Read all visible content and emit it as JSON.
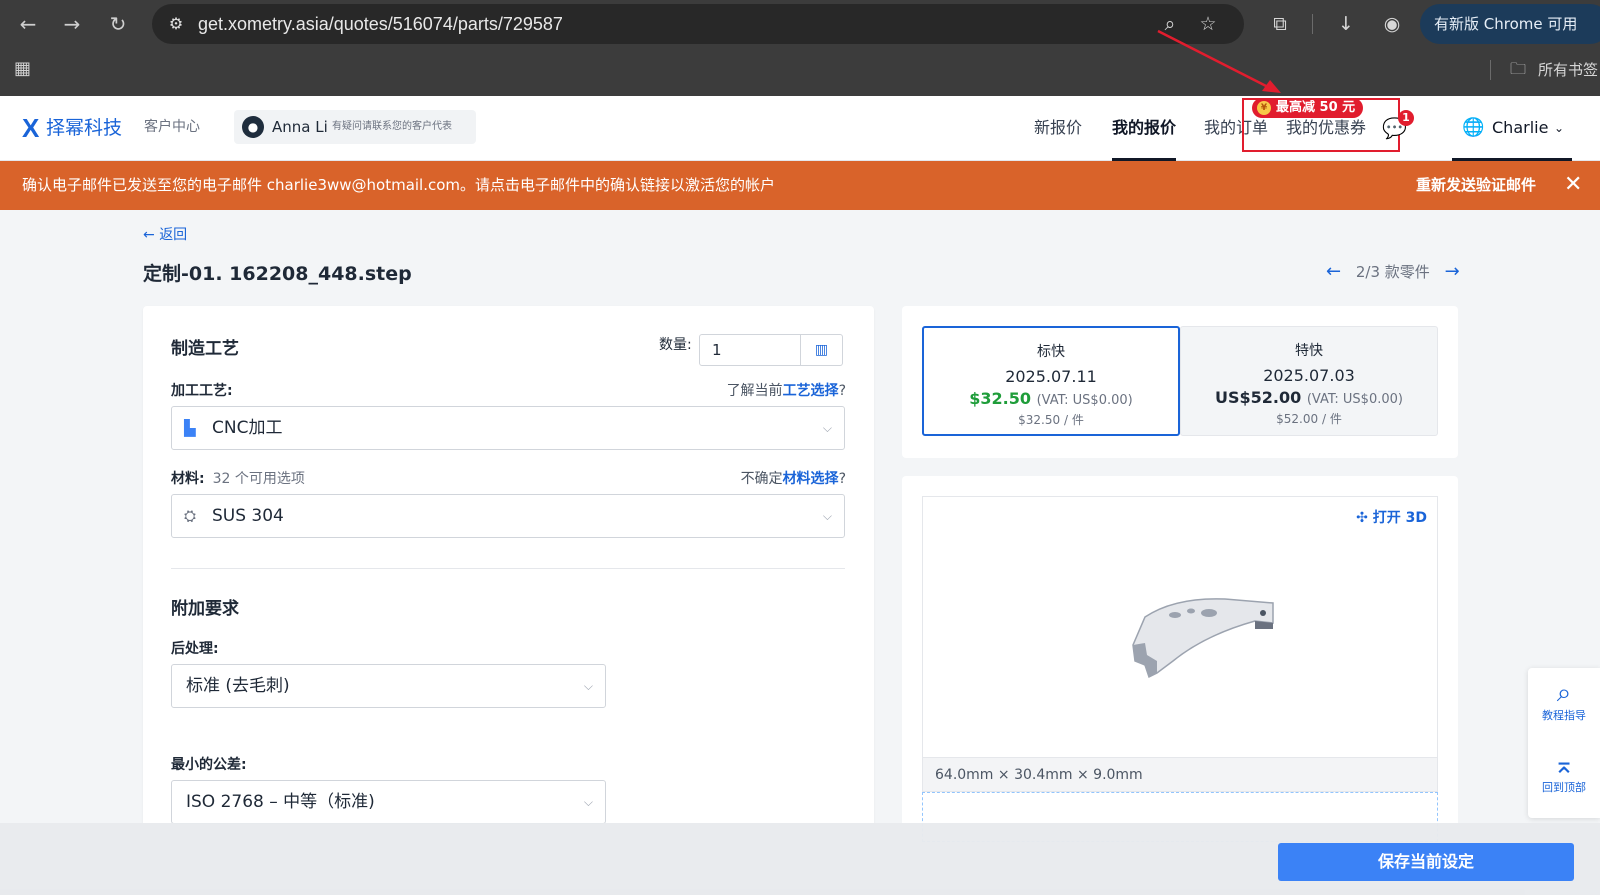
{
  "browser": {
    "url": "get.xometry.asia/quotes/516074/parts/729587",
    "upgrade_label": "有新版 Chrome 可用",
    "bookmarks_label": "所有书签"
  },
  "header": {
    "logo_mark": "X",
    "logo_text": "择幂科技",
    "customer_center": "客户中心",
    "rep_name": "Anna Li",
    "rep_hint": "有疑问请联系您的客户代表",
    "nav": {
      "new_quote": "新报价",
      "my_quotes": "我的报价",
      "my_orders": "我的订单",
      "my_coupons": "我的优惠券"
    },
    "promo_badge": "最高减 50 元",
    "chat_badge_count": "1",
    "user_name": "Charlie"
  },
  "notice": {
    "message": "确认电子邮件已发送至您的电子邮件 charlie3ww@hotmail.com。请点击电子邮件中的确认链接以激活您的帐户",
    "resend_label": "重新发送验证邮件"
  },
  "page": {
    "back_label": "返回",
    "part_title": "定制-01. 162208_448.step",
    "pager_label": "2/3 款零件"
  },
  "config": {
    "manufacturing_title": "制造工艺",
    "quantity_label": "数量:",
    "quantity_value": "1",
    "process_label": "加工工艺:",
    "process_help_prefix": "了解当前",
    "process_help_link": "工艺选择",
    "process_value": "CNC加工",
    "material_label": "材料:",
    "material_options_count": "32 个可用选项",
    "material_help_prefix": "不确定",
    "material_help_link": "材料选择",
    "material_value": "SUS 304",
    "additional_title": "附加要求",
    "finish_label": "后处理:",
    "finish_value": "标准 (去毛刺)",
    "tolerance_label": "最小的公差:",
    "tolerance_value": "ISO 2768 – 中等（标准)"
  },
  "pricing": {
    "options": [
      {
        "name": "标快",
        "date": "2025.07.11",
        "price": "$32.50",
        "vat": "(VAT: US$0.00)",
        "unit": "$32.50 / 件"
      },
      {
        "name": "特快",
        "date": "2025.07.03",
        "price": "US$52.00",
        "vat": "(VAT: US$0.00)",
        "unit": "$52.00 / 件"
      }
    ],
    "colors": {
      "selected_price": "#1f9d3a",
      "other_price": "#1f2937"
    }
  },
  "viewer": {
    "open3d_label": "打开 3D",
    "dimensions": "64.0mm × 30.4mm × 9.0mm"
  },
  "float_help": {
    "tutorial_label": "教程指导",
    "top_label": "回到顶部"
  },
  "footer": {
    "save_label": "保存当前设定"
  }
}
